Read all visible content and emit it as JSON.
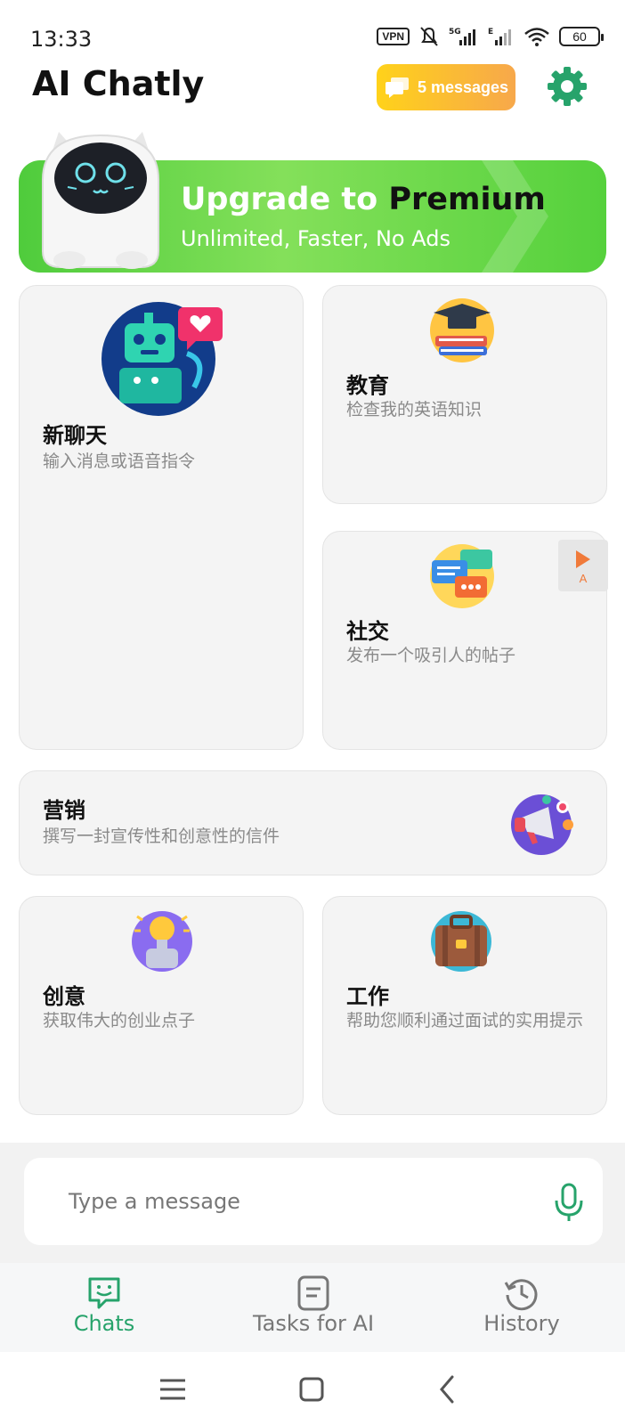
{
  "status_bar": {
    "time": "13:33",
    "vpn": "VPN",
    "battery": "60"
  },
  "header": {
    "title": "AI Chatly",
    "messages_badge": "5 messages"
  },
  "promo": {
    "title_part1": "Upgrade to ",
    "title_part2": "Premium",
    "subtitle": "Unlimited, Faster, No Ads"
  },
  "cards": [
    {
      "title": "新聊天",
      "subtitle": "输入消息或语音指令",
      "icon": "robot-chat-icon"
    },
    {
      "title": "教育",
      "subtitle": "检查我的英语知识",
      "icon": "books-graduation-icon"
    },
    {
      "title": "社交",
      "subtitle": "发布一个吸引人的帖子",
      "icon": "chat-bubbles-icon"
    },
    {
      "title": "营销",
      "subtitle": "撰写一封宣传性和创意性的信件",
      "icon": "megaphone-icon"
    },
    {
      "title": "创意",
      "subtitle": "获取伟大的创业点子",
      "icon": "lightbulb-icon"
    },
    {
      "title": "工作",
      "subtitle": "帮助您顺利通过面试的实用提示",
      "icon": "briefcase-icon"
    }
  ],
  "ad_marker": {
    "label": "A"
  },
  "input": {
    "placeholder": "Type a message"
  },
  "tabs": [
    {
      "label": "Chats",
      "active": true
    },
    {
      "label": "Tasks for AI",
      "active": false
    },
    {
      "label": "History",
      "active": false
    }
  ],
  "colors": {
    "accent": "#27a36b",
    "promo_green": "#5ad43f",
    "badge_yellow": "#ffd21a",
    "badge_orange": "#f7a84b"
  }
}
